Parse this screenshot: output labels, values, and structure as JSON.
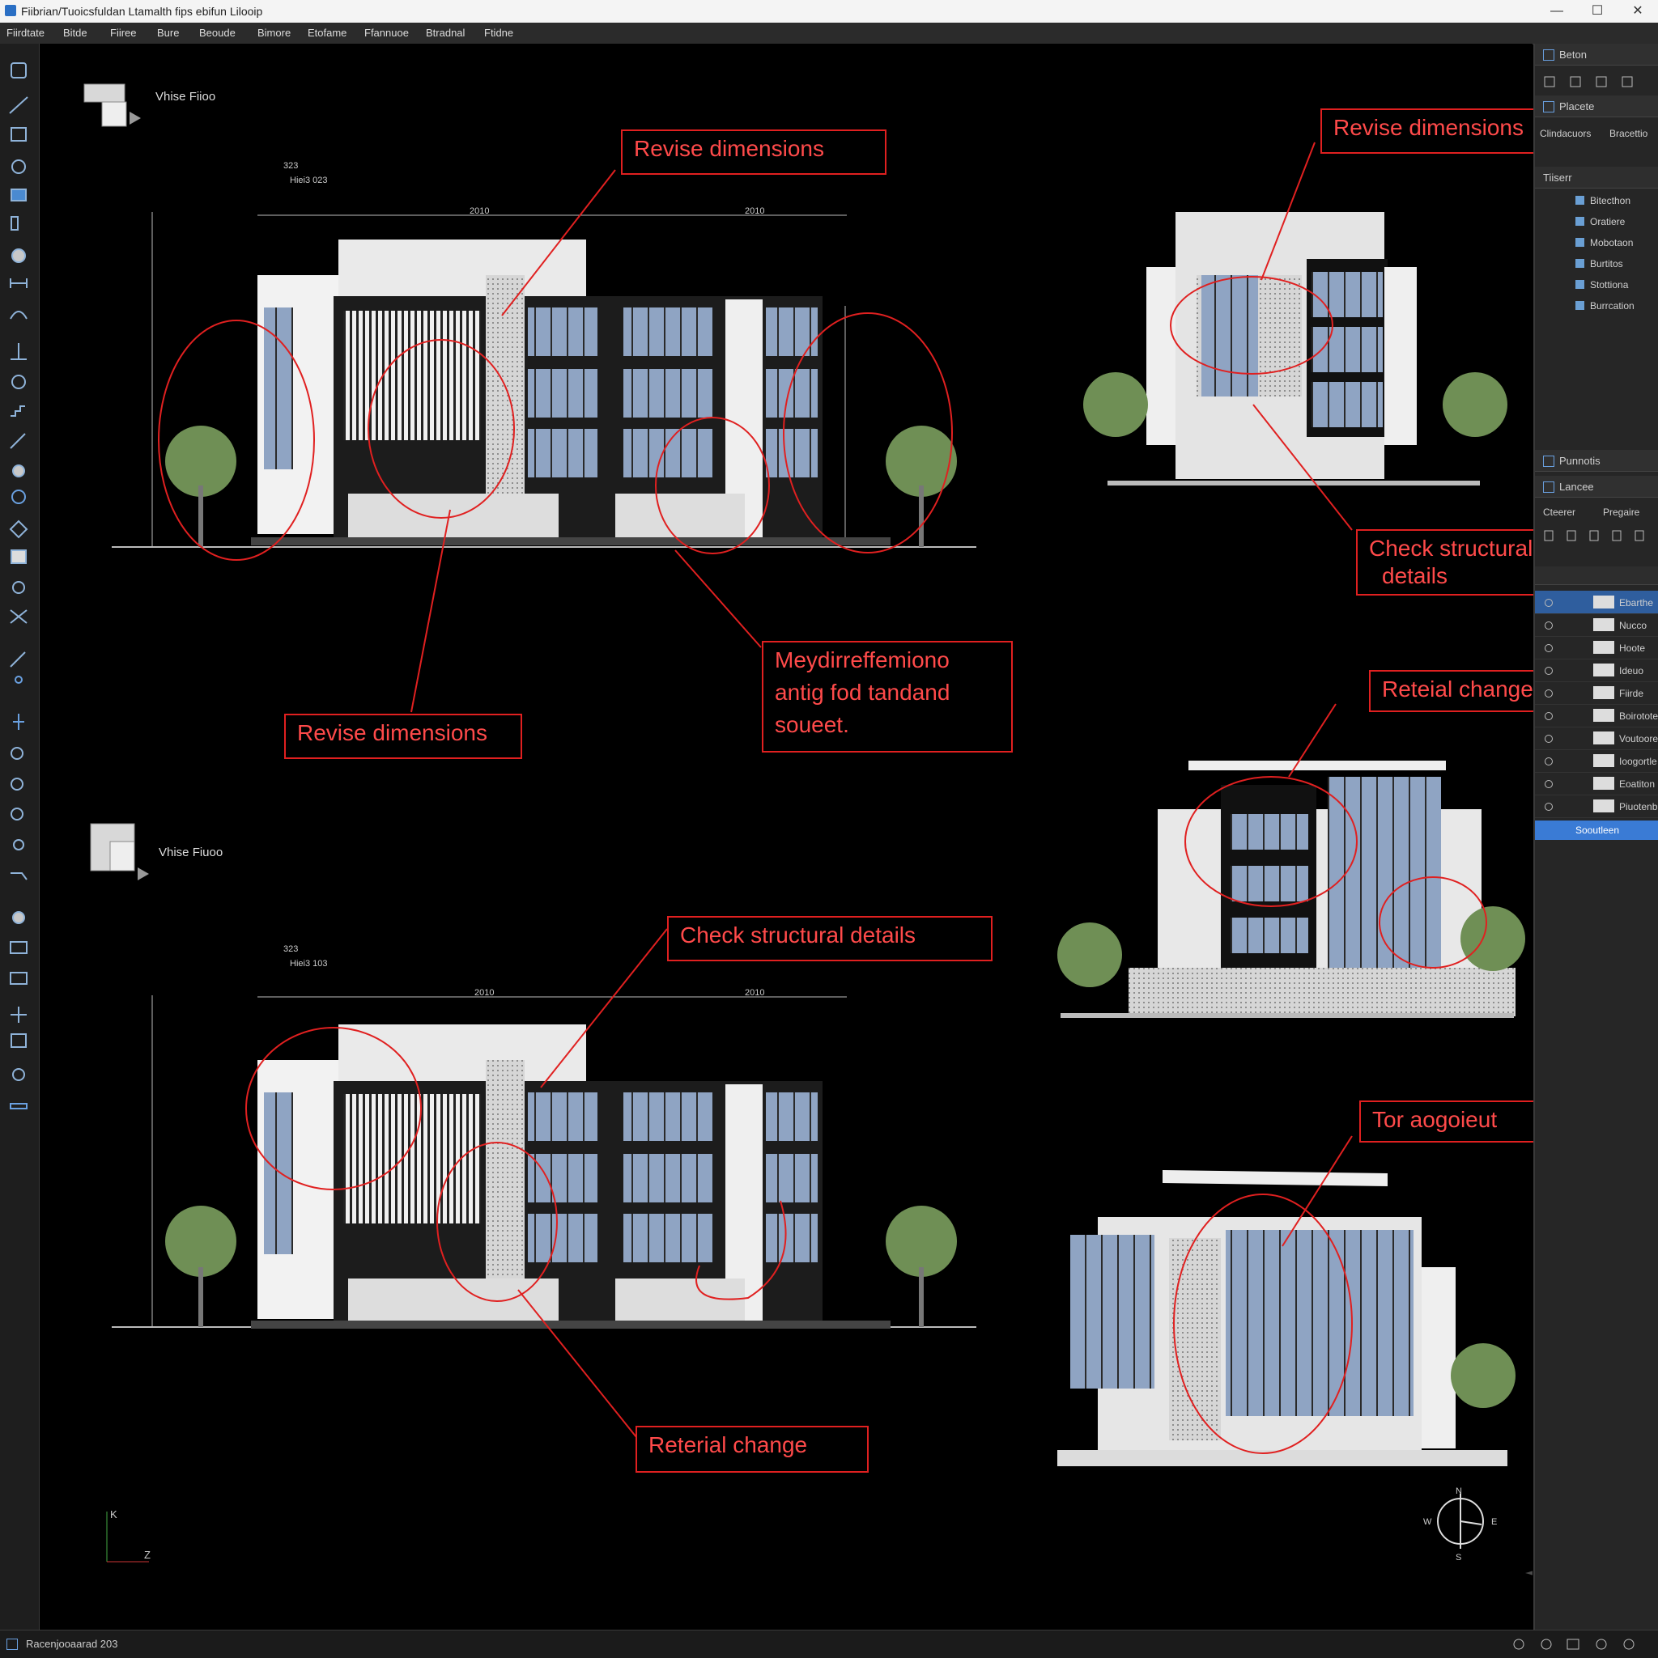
{
  "window": {
    "title": "Fiibrian/Tuoicsfuldan Ltamalth fips ebifun Lilooip",
    "controls": [
      "—",
      "☐",
      "✕"
    ]
  },
  "menu": [
    "Fiirdtate",
    "Bitde",
    "Fiiree",
    "Bure",
    "Beoude",
    "Bimore",
    "Etofame",
    "Ffannuoe",
    "Btradnal",
    "Ftidne"
  ],
  "viewcube": {
    "label_top": "Vhise Fiioo",
    "label_bottom": "Vhise Fiuoo"
  },
  "dims": {
    "top_left": "323",
    "top_sub": "Hiei3 023",
    "span_a": "2010",
    "span_b": "2010",
    "height": "2010",
    "bottom_a": "2010",
    "bottom_b": "2010",
    "bottom_top": "323",
    "bottom_sub": "Hiei3 103"
  },
  "callouts": {
    "c1": "Revise dimensions",
    "c2": "Revise dimensions",
    "c3": "Revise dimensions",
    "c4_line1": "Check structural",
    "c4_line2": "details",
    "c5_line1": "Meydirreffemiono",
    "c5_line2": "antig fod tandand",
    "c5_line3": "soueet.",
    "c6": "Reteial change",
    "c7": "Check structural details",
    "c8": "Tor aogoieut",
    "c9": "Reterial change"
  },
  "panel": {
    "header1": "Beton",
    "header2": "Placete",
    "tabs_a": [
      "Clindacuors",
      "Bracettio"
    ],
    "tree_header": "Tiiserr",
    "tree": [
      "Bitecthon",
      "Oratiere",
      "Mobotaon",
      "Burtitos",
      "Stottiona",
      "Burrcation"
    ],
    "header3": "Punnotis",
    "header4": "Lancee",
    "tabs_b": [
      "Cteerer",
      "Pregaire"
    ],
    "layers": [
      "Ebarthe",
      "Nucco",
      "Hoote",
      "Ideuo",
      "Fiirde",
      "Boirotote",
      "Voutoore",
      "Ioogortle",
      "Eoatiton",
      "Piuotenb"
    ],
    "footer_button": "Sooutleen"
  },
  "status": {
    "text": "Racenjooaarad 203"
  },
  "axis": {
    "y": "K",
    "x": "Z"
  },
  "compass": {
    "n": "N",
    "e": "E",
    "s": "S",
    "w": "W"
  },
  "colors": {
    "markup": "#e02020",
    "accent": "#3a7bd5",
    "background": "#000000"
  }
}
